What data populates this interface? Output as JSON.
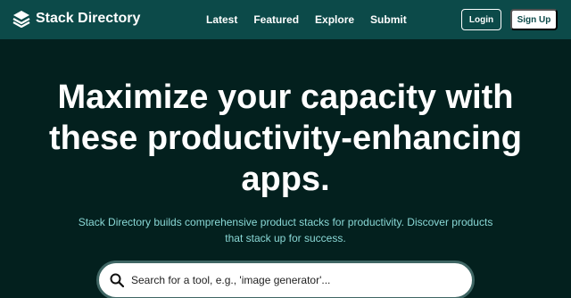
{
  "nav": {
    "brand": "Stack Directory",
    "links": [
      "Latest",
      "Featured",
      "Explore",
      "Submit"
    ],
    "login_label": "Login",
    "signup_label": "Sign Up"
  },
  "hero": {
    "title": "Maximize your capacity with these productivity-enhancing apps.",
    "subtitle": "Stack Directory builds comprehensive product stacks for productivity. Discover products that stack up for success."
  },
  "search": {
    "placeholder": "Search for a tool, e.g., 'image generator'..."
  },
  "colors": {
    "background": "#03201e",
    "navbar": "#0c4a49",
    "subtitle": "#8ad8d6"
  }
}
